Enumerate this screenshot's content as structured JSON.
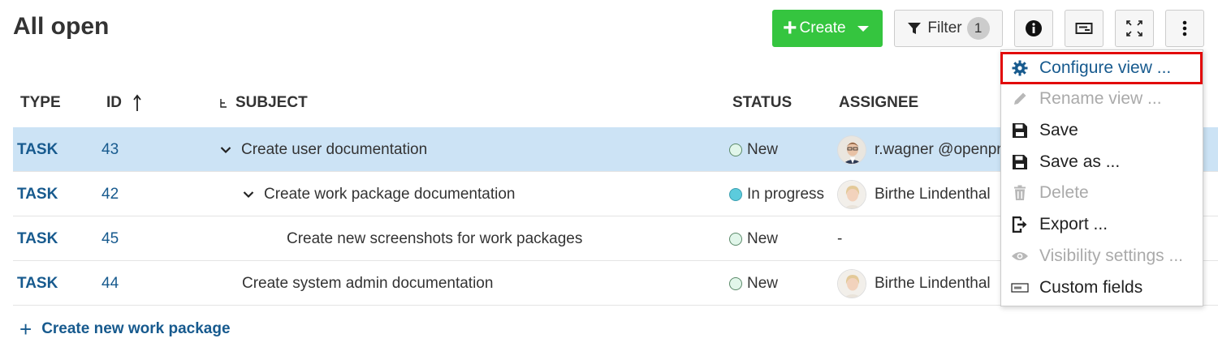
{
  "page": {
    "title": "All open"
  },
  "toolbar": {
    "create_label": "Create",
    "filter_label": "Filter",
    "filter_count": "1"
  },
  "table": {
    "headers": {
      "type": "TYPE",
      "id": "ID",
      "subject": "SUBJECT",
      "status": "STATUS",
      "assignee": "ASSIGNEE"
    },
    "rows": [
      {
        "type": "TASK",
        "id": "43",
        "subject": "Create user documentation",
        "status": "New",
        "assignee": "r.wagner @openproject"
      },
      {
        "type": "TASK",
        "id": "42",
        "subject": "Create work package documentation",
        "status": "In progress",
        "assignee": "Birthe Lindenthal"
      },
      {
        "type": "TASK",
        "id": "45",
        "subject": "Create new screenshots for work packages",
        "status": "New",
        "assignee": "-"
      },
      {
        "type": "TASK",
        "id": "44",
        "subject": "Create system admin documentation",
        "status": "New",
        "assignee": "Birthe Lindenthal"
      }
    ]
  },
  "footer": {
    "create_new_label": "Create new work package"
  },
  "menu": {
    "items": [
      {
        "label": "Configure view ...",
        "icon": "gear-icon"
      },
      {
        "label": "Rename view ...",
        "icon": "pencil-icon"
      },
      {
        "label": "Save",
        "icon": "floppy-icon"
      },
      {
        "label": "Save as ...",
        "icon": "floppy-icon"
      },
      {
        "label": "Delete",
        "icon": "trash-icon"
      },
      {
        "label": "Export ...",
        "icon": "export-icon"
      },
      {
        "label": "Visibility settings ...",
        "icon": "eye-icon"
      },
      {
        "label": "Custom fields",
        "icon": "custom-field-icon"
      }
    ]
  },
  "colors": {
    "accent": "#175a8e",
    "create": "#35c53f",
    "selected_row": "#cce3f5",
    "highlight_border": "#e20a0a"
  }
}
